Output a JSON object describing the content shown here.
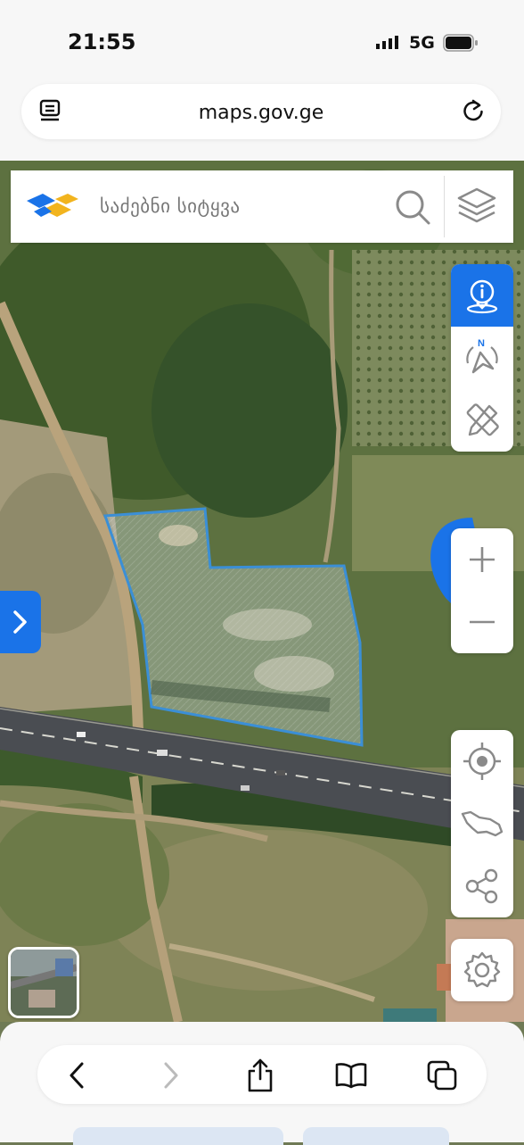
{
  "status": {
    "time": "21:55",
    "network": "5G"
  },
  "browser": {
    "url": "maps.gov.ge"
  },
  "search": {
    "placeholder": "საძებნი სიტყვა"
  },
  "colors": {
    "accent": "#1a73e8",
    "parcel_stroke": "#3b8fd6"
  },
  "icons": {
    "right_panel_top": [
      "info-location-icon",
      "compass-north-icon",
      "measure-tools-icon"
    ],
    "zoom": [
      "zoom-in-icon",
      "zoom-out-icon"
    ],
    "right_panel_bottom": [
      "my-location-icon",
      "georgia-map-icon",
      "share-icon"
    ],
    "settings": "gear-icon"
  }
}
